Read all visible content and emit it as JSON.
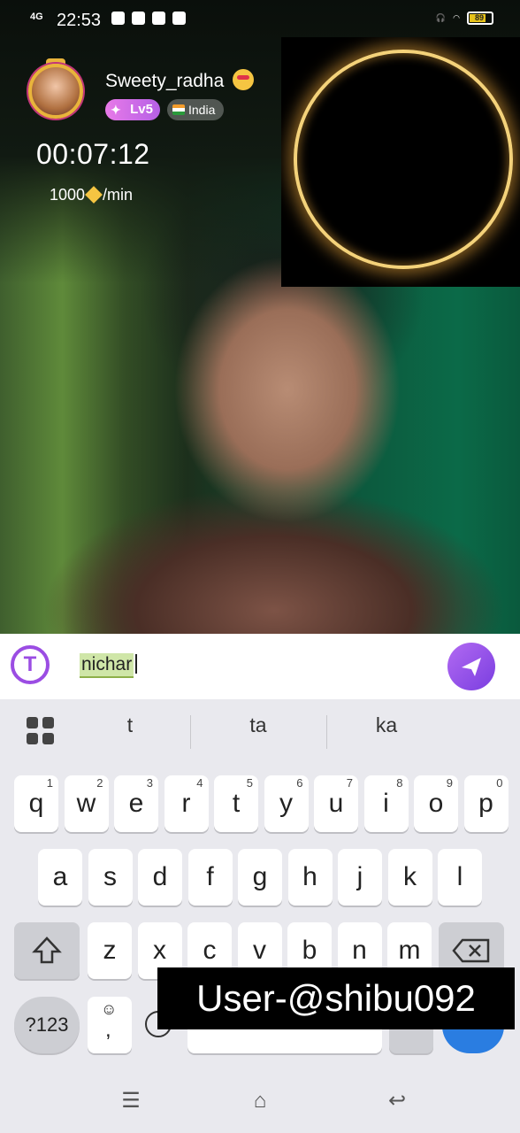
{
  "status_bar": {
    "network": "4G",
    "time": "22:53",
    "battery": "89"
  },
  "host": {
    "name": "Sweety_radha",
    "level": "Lv5",
    "country": "India"
  },
  "call": {
    "timer": "00:07:12",
    "rate": "1000",
    "rate_unit": "/min"
  },
  "chat": {
    "typed_text": "nichar"
  },
  "keyboard": {
    "suggestions": [
      "t",
      "ta",
      "ka"
    ],
    "row1": [
      {
        "k": "q",
        "n": "1"
      },
      {
        "k": "w",
        "n": "2"
      },
      {
        "k": "e",
        "n": "3"
      },
      {
        "k": "r",
        "n": "4"
      },
      {
        "k": "t",
        "n": "5"
      },
      {
        "k": "y",
        "n": "6"
      },
      {
        "k": "u",
        "n": "7"
      },
      {
        "k": "i",
        "n": "8"
      },
      {
        "k": "o",
        "n": "9"
      },
      {
        "k": "p",
        "n": "0"
      }
    ],
    "row2": [
      "a",
      "s",
      "d",
      "f",
      "g",
      "h",
      "j",
      "k",
      "l"
    ],
    "row3": [
      "z",
      "x",
      "c",
      "v",
      "b",
      "n",
      "m"
    ],
    "symbols_label": "?123",
    "comma_label": ","
  },
  "overlay": {
    "watermark": "User-@shibu092"
  },
  "colors": {
    "accent": "#9b4de3",
    "keyboard_bg": "#e9e9ee",
    "enter_key": "#2a7de1"
  }
}
